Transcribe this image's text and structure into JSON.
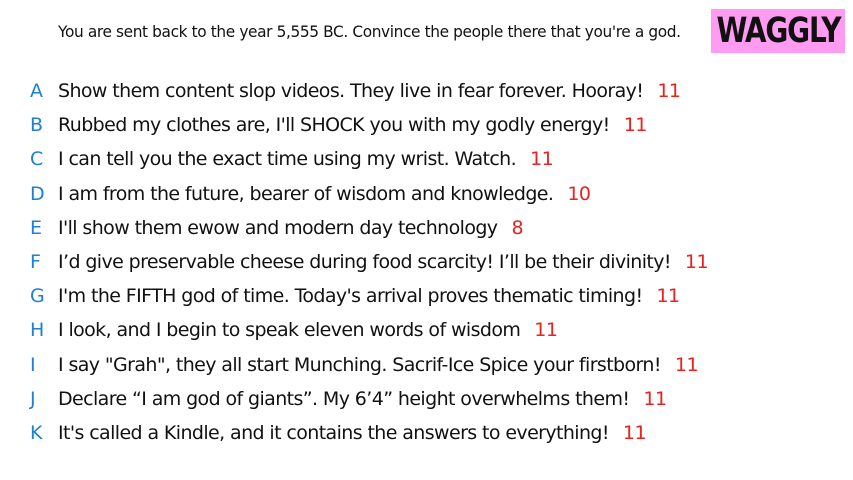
{
  "prompt": "You are sent back to the year 5,555 BC. Convince the people there that you're a god.",
  "brand": {
    "name": "WAGGLY",
    "background": "#ff9cf2"
  },
  "colors": {
    "letter": "#1e7fd6",
    "score": "#e8231f",
    "text": "#111111"
  },
  "answers": [
    {
      "letter": "A",
      "text": "Show them content slop videos. They live in fear forever. Hooray!",
      "score": "11"
    },
    {
      "letter": "B",
      "text": "Rubbed my clothes are, I'll SHOCK you with my godly energy!",
      "score": "11"
    },
    {
      "letter": "C",
      "text": "I can tell you the exact time using my wrist. Watch.",
      "score": "11"
    },
    {
      "letter": "D",
      "text": "I am from the future, bearer of wisdom and knowledge.",
      "score": "10"
    },
    {
      "letter": "E",
      "text": "I'll show them ewow and modern day technology",
      "score": "8"
    },
    {
      "letter": "F",
      "text": "I’d give preservable cheese during food scarcity! I’ll be their divinity!",
      "score": "11"
    },
    {
      "letter": "G",
      "text": "I'm the FIFTH god of time. Today's arrival proves thematic timing!",
      "score": "11"
    },
    {
      "letter": "H",
      "text": "I look, and I begin to speak eleven words of wisdom",
      "score": "11"
    },
    {
      "letter": "I",
      "text": "I say \"Grah\", they all start Munching. Sacrif-Ice Spice your firstborn!",
      "score": "11"
    },
    {
      "letter": "J",
      "text": "Declare “I am god of giants”. My 6’4” height overwhelms them!",
      "score": "11"
    },
    {
      "letter": "K",
      "text": "It's called a Kindle, and it contains the answers to everything!",
      "score": "11"
    }
  ]
}
